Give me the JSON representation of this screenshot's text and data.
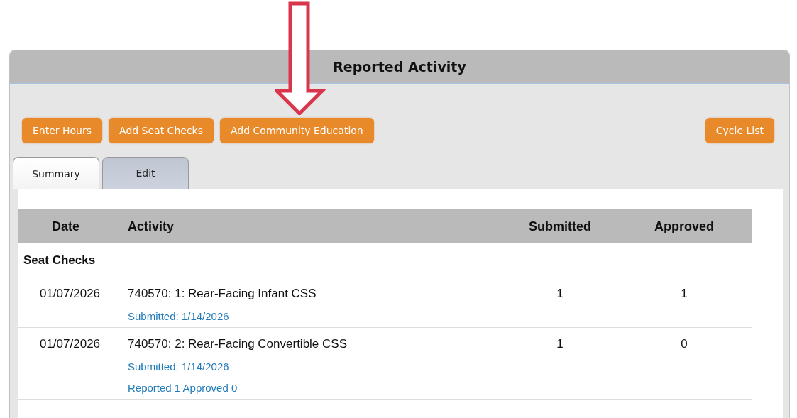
{
  "panel": {
    "title": "Reported Activity"
  },
  "toolbar": {
    "left_buttons": [
      "Enter Hours",
      "Add Seat Checks",
      "Add Community Education"
    ],
    "right_buttons": [
      "Cycle List"
    ]
  },
  "tabs": [
    {
      "label": "Summary",
      "selected": true
    },
    {
      "label": "Edit",
      "selected": false
    }
  ],
  "table": {
    "columns": [
      "Date",
      "Activity",
      "Submitted",
      "Approved"
    ],
    "group": "Seat Checks",
    "rows": [
      {
        "date": "01/07/2026",
        "activity": "740570: 1: Rear-Facing Infant CSS",
        "notes": [
          "Submitted: 1/14/2026"
        ],
        "submitted": "1",
        "approved": "1"
      },
      {
        "date": "01/07/2026",
        "activity": "740570: 2: Rear-Facing Convertible CSS",
        "notes": [
          "Submitted: 1/14/2026",
          "Reported 1 Approved 0"
        ],
        "submitted": "1",
        "approved": "0"
      }
    ]
  }
}
